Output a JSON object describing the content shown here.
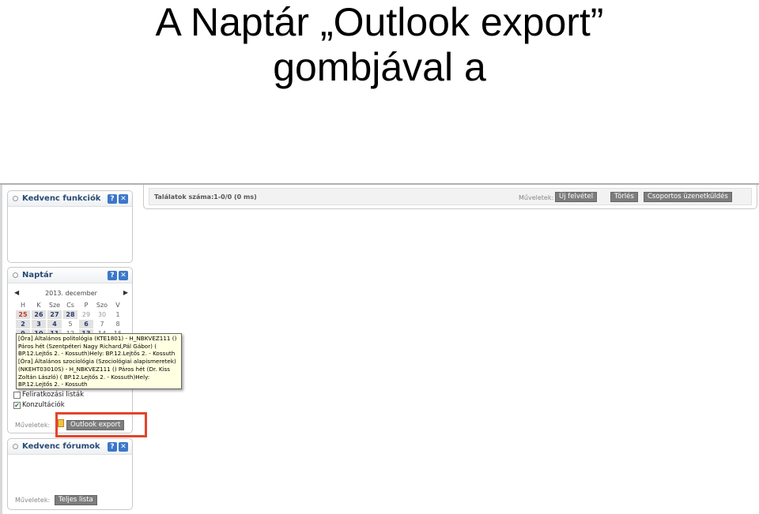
{
  "slide": {
    "title_line1": "A Naptár „Outlook export”",
    "title_line2": "gombjával a"
  },
  "panels": {
    "favorites": {
      "title": "Kedvenc funkciók"
    },
    "calendar": {
      "title": "Naptár",
      "month": "2013. december",
      "prev": "◀",
      "next": "▶",
      "weekdays": [
        "H",
        "K",
        "Sze",
        "Cs",
        "P",
        "Szo",
        "V"
      ],
      "weeks": [
        [
          "25",
          "26",
          "27",
          "28",
          "29",
          "30",
          "1"
        ],
        [
          "2",
          "3",
          "4",
          "5",
          "6",
          "7",
          "8"
        ],
        [
          "9",
          "10",
          "11",
          "12",
          "13",
          "14",
          "15"
        ]
      ],
      "tooltip_lines": [
        "[Óra] Általános politológia (KTE1801) - H_NBKVEZ111 ()",
        "Páros hét (Szentpéteri Nagy Richard,Pál Gábor) (",
        "BP.12.Lejtős 2. - Kossuth)Hely: BP.12.Lejtős 2. - Kossuth",
        "[Óra] Általános szociológia (Szociológiai alapismeretek)",
        "(NKEHT03010S) - H_NBKVEZ111 () Páros hét (Dr. Kiss",
        "Zoltán László) ( BP.12.Lejtős 2. - Kossuth)Hely:",
        "BP.12.Lejtős 2. - Kossuth"
      ],
      "filters": [
        {
          "label": "Feliratkozási listák",
          "checked": false
        },
        {
          "label": "Konzultációk",
          "checked": true
        }
      ],
      "ops_label": "Műveletek:",
      "outlook_export": "Outlook export"
    },
    "forums": {
      "title": "Kedvenc fórumok",
      "ops_label": "Műveletek:",
      "full_list": "Teljes lista"
    }
  },
  "main": {
    "results": "Találatok száma:1-0/0 (0 ms)",
    "ops_label": "Műveletek:",
    "buttons": {
      "new": "Új felvétel",
      "delete": "Törlés",
      "group_message": "Csoportos üzenetküldés"
    }
  },
  "icons": {
    "help": "help-icon",
    "close": "close-icon",
    "pin": "pin-icon"
  },
  "colors": {
    "highlight": "#e2452b",
    "button_gray": "#7d7d7d",
    "panel_title": "#2a4a72",
    "tooltip_bg": "#ffffe1"
  }
}
